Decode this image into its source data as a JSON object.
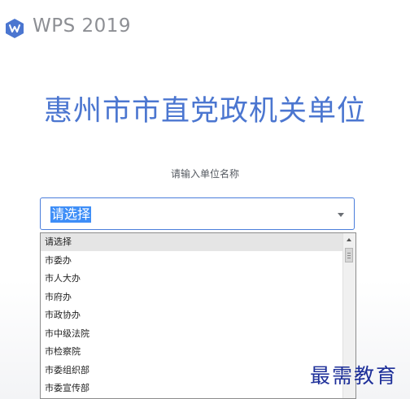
{
  "app": {
    "brand": "WPS 2019",
    "logo_icon": "wps-logo-icon",
    "accent": "#4b76d0"
  },
  "main": {
    "org_title": "惠州市市直党政机关单位",
    "prompt": "请输入单位名称",
    "select_value": "请选择"
  },
  "dropdown": {
    "options": [
      "请选择",
      "市委办",
      "市人大办",
      "市府办",
      "市政协办",
      "市中级法院",
      "市检察院",
      "市委组织部",
      "市委宣传部"
    ],
    "selected_index": 0
  },
  "watermark": "最需教育"
}
